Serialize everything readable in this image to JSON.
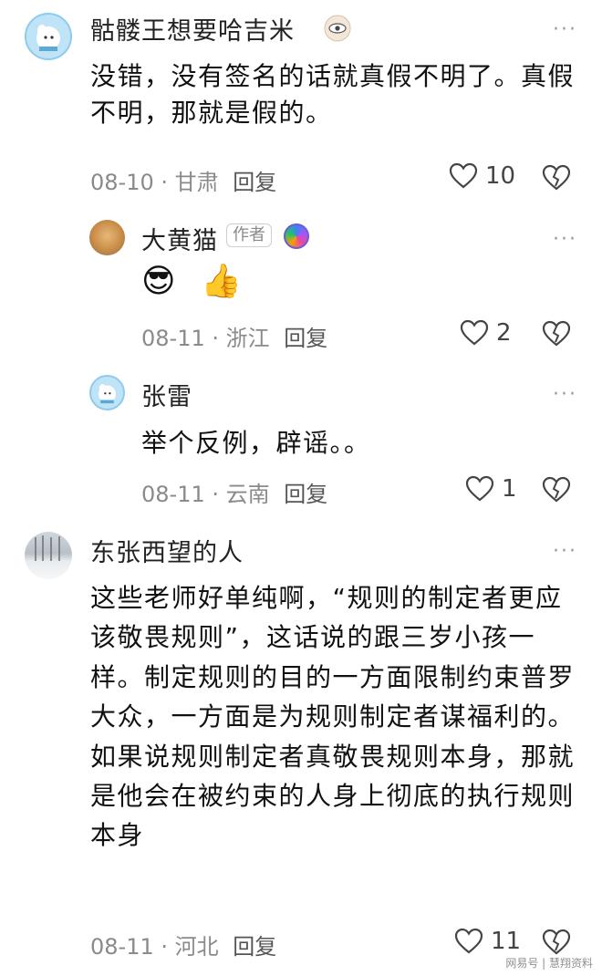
{
  "comments": [
    {
      "user": "骷髅王想要哈吉米",
      "text": "没错，没有签名的话就真假不明了。真假不明，那就是假的。",
      "date": "08-10",
      "location": "甘肃",
      "reply_label": "回复",
      "likes": "10"
    },
    {
      "user": "大黄猫",
      "tag": "作者",
      "text": "😎 👍",
      "date": "08-11",
      "location": "浙江",
      "reply_label": "回复",
      "likes": "2"
    },
    {
      "user": "张雷",
      "text": "举个反例，辟谣。。",
      "date": "08-11",
      "location": "云南",
      "reply_label": "回复",
      "likes": "1"
    },
    {
      "user": "东张西望的人",
      "text": "这些老师好单纯啊，“规则的制定者更应该敬畏规则”，这话说的跟三岁小孩一样。制定规则的目的一方面限制约束普罗大众，一方面是为规则制定者谋福利的。如果说规则制定者真敬畏规则本身，那就是他会在被约束的人身上彻底的执行规则本身",
      "date": "08-11",
      "location": "河北",
      "reply_label": "回复",
      "likes": "11"
    }
  ],
  "watermark": "网易号 | 慧翔资料",
  "colors": {
    "text": "#111111",
    "meta": "#8a8a8a",
    "background": "#ffffff"
  }
}
